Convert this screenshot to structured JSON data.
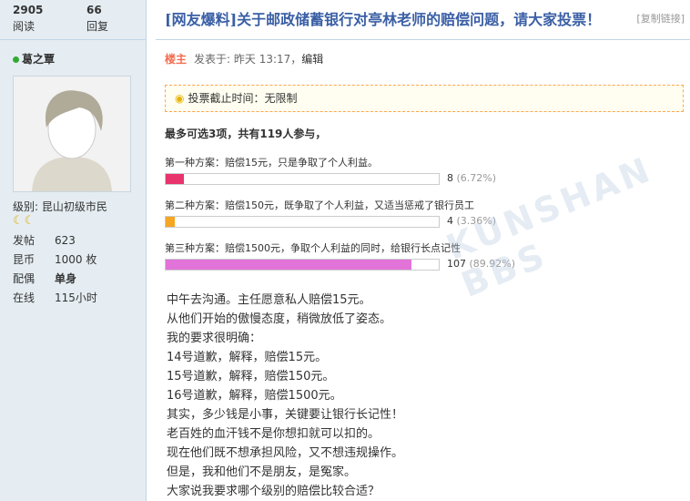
{
  "stats": {
    "views_num": "2905",
    "views_label": "阅读",
    "replies_num": "66",
    "replies_label": "回复"
  },
  "author": {
    "name": "葛之覃",
    "level": "级别: 昆山初级市民",
    "moons": "☾☾",
    "profile": [
      {
        "k": "发帖",
        "v": "623"
      },
      {
        "k": "昆币",
        "v": "1000 枚"
      },
      {
        "k": "配偶",
        "v": "单身"
      },
      {
        "k": "在线",
        "v": "115小时"
      }
    ]
  },
  "thread": {
    "title": "[网友爆料]关于邮政储蓄银行对亭林老师的赔偿问题，请大家投票！",
    "copy_link": "[复制链接]"
  },
  "post": {
    "host": "楼主",
    "posted": "发表于: 昨天 13:17，",
    "edit": "编辑"
  },
  "poll": {
    "deadline": "投票截止时间：无限制",
    "summary": "最多可选3项，共有119人参与，",
    "options": [
      {
        "label": "第一种方案：赔偿15元，只是争取了个人利益。",
        "count": "8",
        "percent_text": "(6.72%)",
        "percent": 6.72,
        "color": "#e8336d"
      },
      {
        "label": "第二种方案：赔偿150元，既争取了个人利益，又适当惩戒了银行员工",
        "count": "4",
        "percent_text": "(3.36%)",
        "percent": 3.36,
        "color": "#f5a623"
      },
      {
        "label": "第三种方案：赔偿1500元，争取个人利益的同时，给银行长点记性",
        "count": "107",
        "percent_text": "(89.92%)",
        "percent": 89.92,
        "color": "#e273d8"
      }
    ]
  },
  "content": [
    "中午去沟通。主任愿意私人赔偿15元。",
    "从他们开始的傲慢态度，稍微放低了姿态。",
    "我的要求很明确：",
    "14号道歉，解释，赔偿15元。",
    "15号道歉，解释，赔偿150元。",
    "16号道歉，解释，赔偿1500元。",
    "其实，多少钱是小事，关键要让银行长记性！",
    "老百姓的血汗钱不是你想扣就可以扣的。",
    "现在他们既不想承担风险，又不想违规操作。",
    "但是，我和他们不是朋友，是冤家。",
    "大家说我要求哪个级别的赔偿比较合适？"
  ],
  "watermark": "KUNSHAN BBS"
}
